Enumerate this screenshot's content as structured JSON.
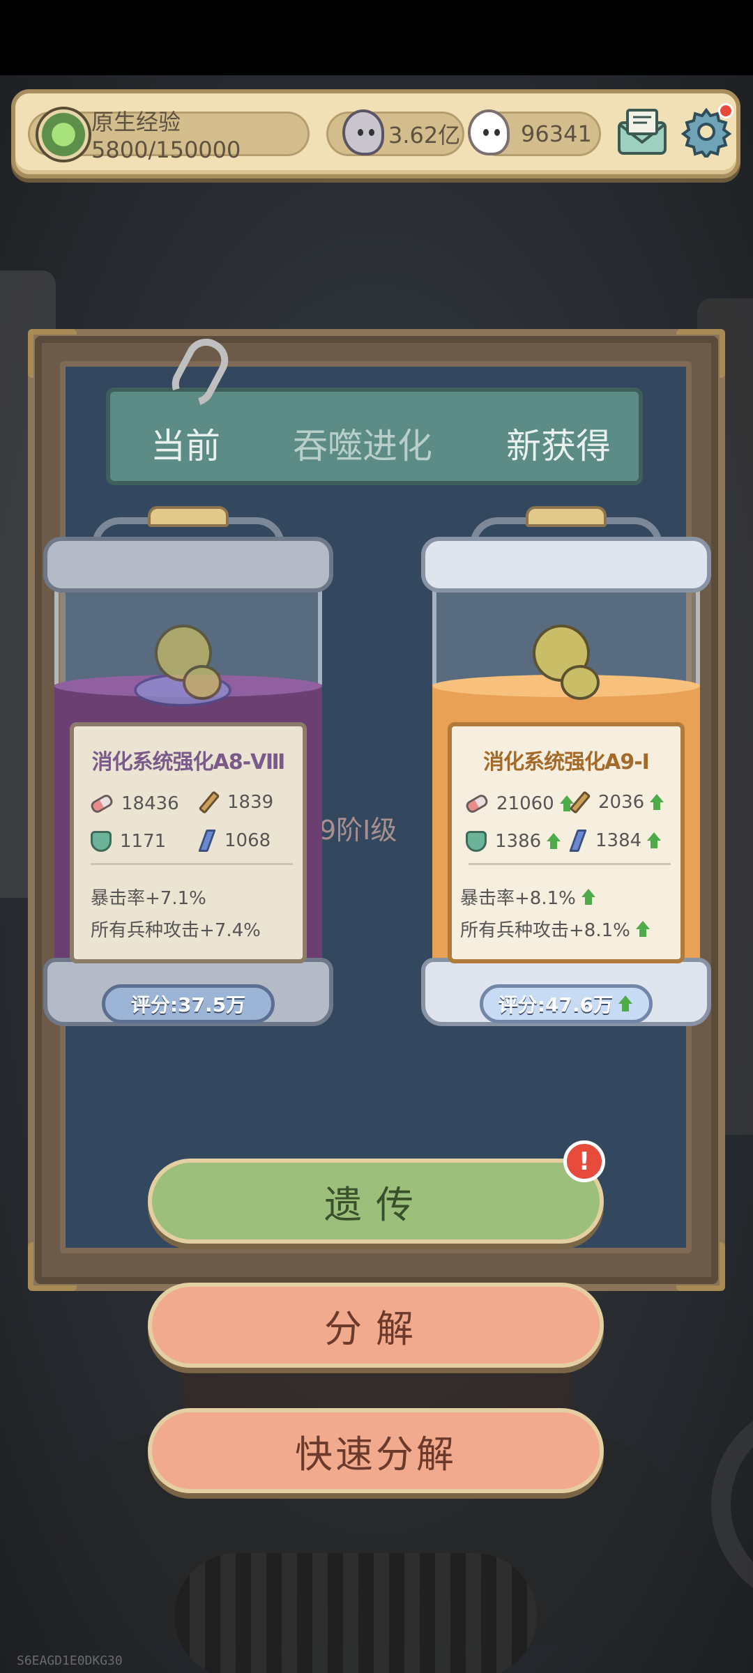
{
  "topbar": {
    "exp_label": "原生经验5800/150000",
    "gold_value": "3.62亿",
    "gem_value": "96341"
  },
  "tabs": {
    "current": "当前",
    "evolve": "吞噬进化",
    "new": "新获得"
  },
  "background": {
    "level_text": "态9阶I级"
  },
  "current_item": {
    "title": "消化系统强化A8-Ⅷ",
    "hp": "18436",
    "attack": "1839",
    "defense": "1171",
    "speed": "1068",
    "bonus1": "暴击率+7.1%",
    "bonus2": "所有兵种攻击+7.4%",
    "score": "评分:37.5万"
  },
  "new_item": {
    "title": "消化系统强化A9-Ⅰ",
    "hp": "21060",
    "attack": "2036",
    "defense": "1386",
    "speed": "1384",
    "bonus1": "暴击率+8.1%",
    "bonus2": "所有兵种攻击+8.1%",
    "score": "评分:47.6万"
  },
  "actions": {
    "inherit": "遗传",
    "decompose": "分解",
    "quick_decompose": "快速分解",
    "alert_mark": "!"
  },
  "colors": {
    "accent_green": "#9cbf7c",
    "accent_orange": "#f2aa8e",
    "up_arrow": "#4faa4a"
  },
  "watermark": "S6EAGD1E0DKG30"
}
